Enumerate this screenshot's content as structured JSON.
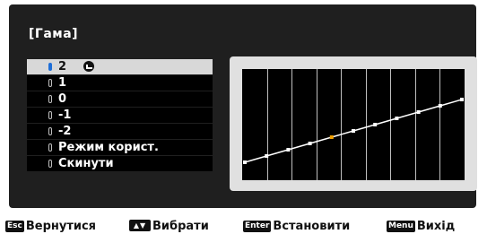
{
  "panel": {
    "title": "[Гама]"
  },
  "menu": {
    "selected_index": 0,
    "items": [
      {
        "label": "2"
      },
      {
        "label": "1"
      },
      {
        "label": "0"
      },
      {
        "label": "-1"
      },
      {
        "label": "-2"
      },
      {
        "label": "Режим корист."
      },
      {
        "label": "Скинути"
      }
    ]
  },
  "graph": {
    "gridlines_vertical": 8,
    "curve_points": [
      0,
      0.1,
      0.2,
      0.3,
      0.4,
      0.5,
      0.6,
      0.7,
      0.8,
      0.9,
      1.0
    ],
    "highlight_index": 4,
    "colors": {
      "line": "#ffffff",
      "point": "#ffffff",
      "highlight": "#f0a000",
      "background": "#000000"
    }
  },
  "helpbar": {
    "back": {
      "key": "Esc",
      "label": "Вернутися"
    },
    "select": {
      "key": "▲▼",
      "label": "Вибрати"
    },
    "enter": {
      "key": "Enter",
      "label": "Встановити"
    },
    "exit": {
      "key": "Menu",
      "label": "Вихід"
    }
  }
}
